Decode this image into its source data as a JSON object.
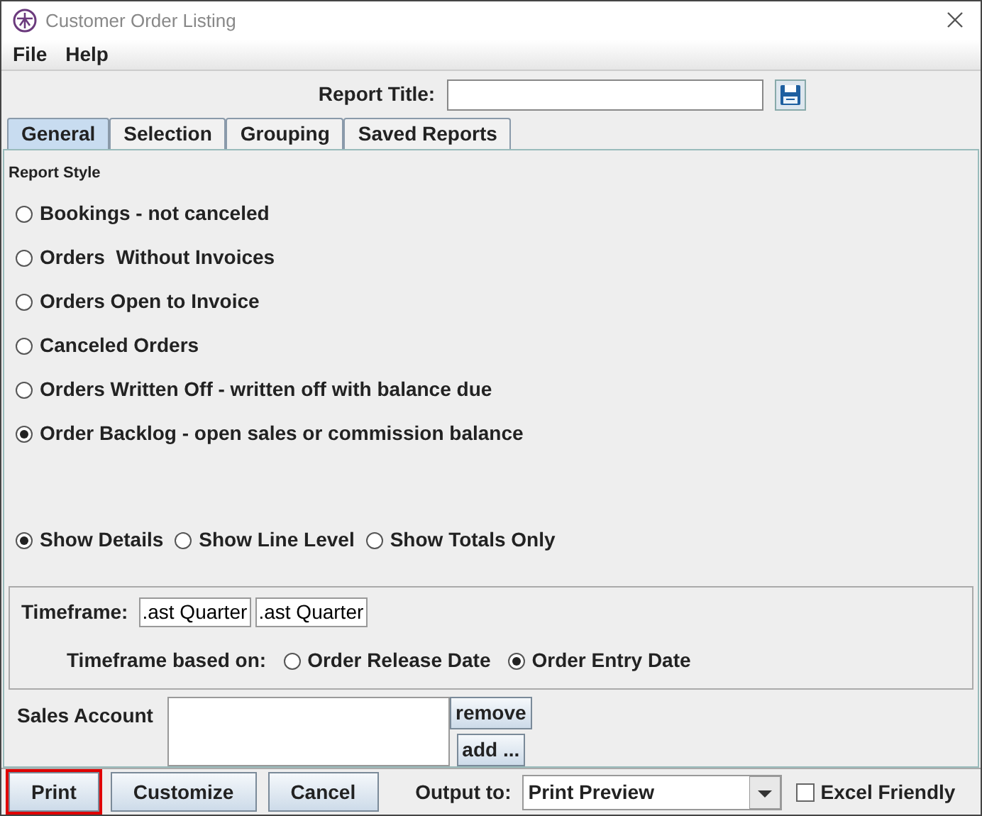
{
  "window": {
    "title": "Customer Order Listing"
  },
  "menu": [
    "File",
    "Help"
  ],
  "report_title": {
    "label": "Report Title:"
  },
  "tabs": [
    {
      "label": "General",
      "selected": true
    },
    {
      "label": "Selection",
      "selected": false
    },
    {
      "label": "Grouping",
      "selected": false
    },
    {
      "label": "Saved Reports",
      "selected": false
    }
  ],
  "report_style": {
    "heading": "Report Style",
    "options": [
      {
        "label": "Bookings - not canceled",
        "selected": false
      },
      {
        "label": "Orders  Without Invoices",
        "selected": false
      },
      {
        "label": "Orders Open to Invoice",
        "selected": false
      },
      {
        "label": "Canceled Orders",
        "selected": false
      },
      {
        "label": "Orders Written Off - written off with balance due",
        "selected": false
      },
      {
        "label": "Order Backlog - open sales or commission balance",
        "selected": true
      }
    ]
  },
  "detail_level": [
    {
      "label": "Show Details",
      "selected": true
    },
    {
      "label": "Show Line Level",
      "selected": false
    },
    {
      "label": "Show Totals Only",
      "selected": false
    }
  ],
  "timeframe": {
    "label": "Timeframe:",
    "from": ".ast Quarter",
    "to": ".ast Quarter",
    "based_on_label": "Timeframe based on:",
    "based_on": [
      {
        "label": "Order Release Date",
        "selected": false
      },
      {
        "label": "Order Entry Date",
        "selected": true
      }
    ]
  },
  "sales_account": {
    "label": "Sales Account",
    "buttons": [
      "remove",
      "add ..."
    ]
  },
  "footer": {
    "buttons": [
      {
        "label": "Print",
        "focused": true
      },
      {
        "label": "Customize",
        "focused": false
      },
      {
        "label": "Cancel",
        "focused": false
      }
    ],
    "output_label": "Output to:",
    "output_value": "Print Preview",
    "excel_friendly": {
      "label": "Excel Friendly",
      "checked": false
    }
  }
}
